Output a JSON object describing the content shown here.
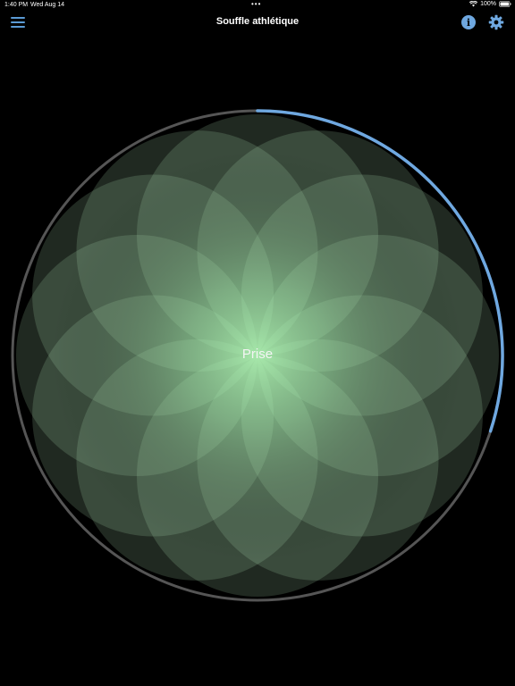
{
  "status_bar": {
    "time": "1:40 PM",
    "date": "Wed Aug 14",
    "dots": "•••",
    "battery": "100%"
  },
  "nav": {
    "title": "Souffle athlétique",
    "menu_icon": "hamburger-menu-icon",
    "info_icon": "info-icon",
    "settings_icon": "gear-icon"
  },
  "breath": {
    "phase_label": "Prise",
    "progress": 0.3
  },
  "colors": {
    "accent": "#6fa8e0",
    "petal": "#c4ffcc",
    "center_glow": "#b4ffb8",
    "background": "#000000"
  }
}
